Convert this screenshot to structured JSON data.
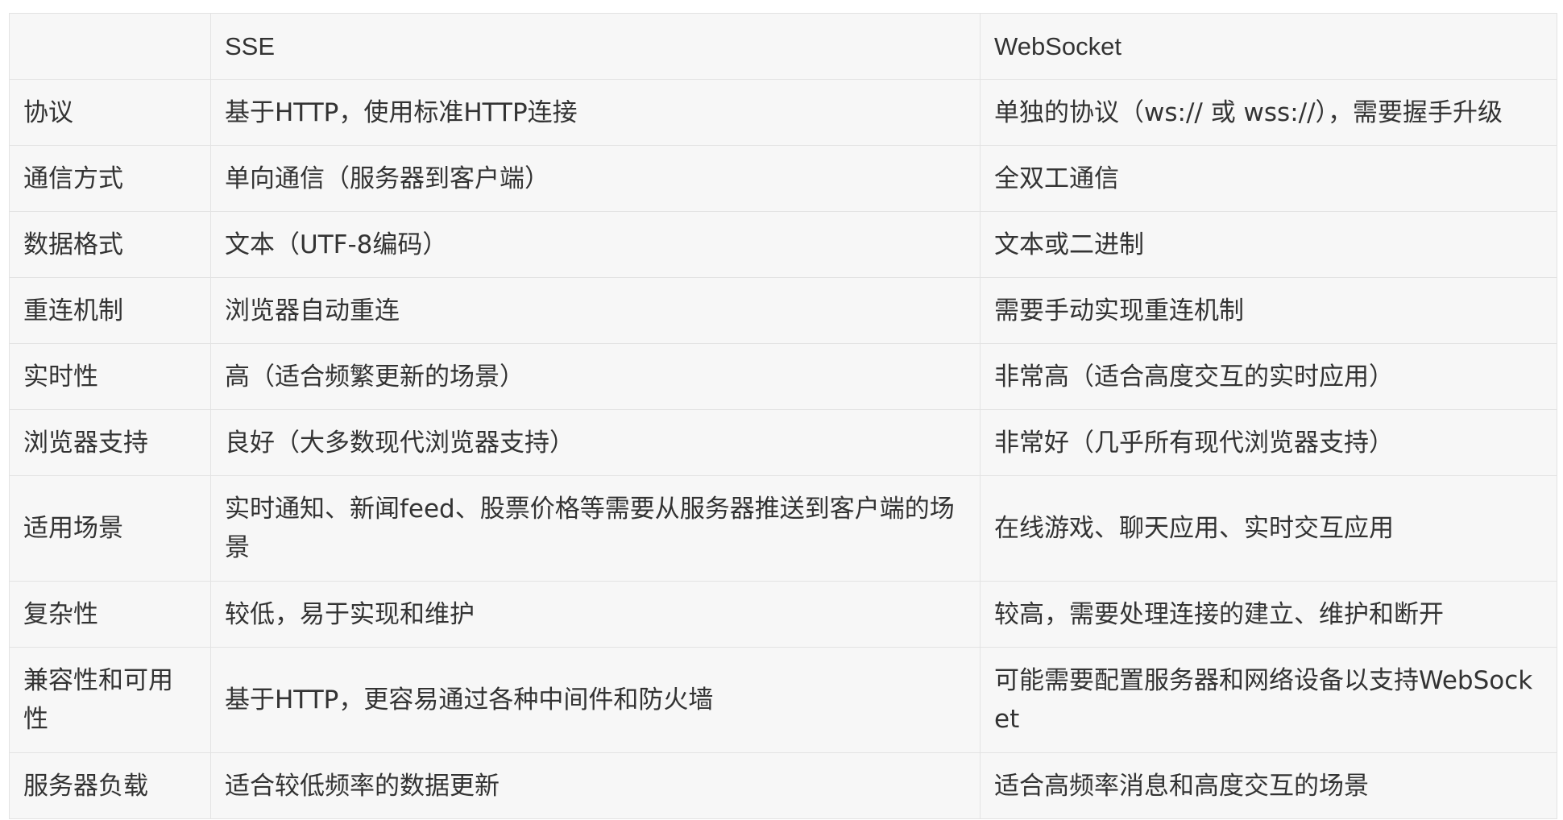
{
  "table": {
    "header": [
      "",
      "SSE",
      "WebSocket"
    ],
    "rows": [
      [
        "协议",
        "基于HTTP，使用标准HTTP连接",
        "单独的协议（ws:// 或 wss://），需要握手升级"
      ],
      [
        "通信方式",
        "单向通信（服务器到客户端）",
        "全双工通信"
      ],
      [
        "数据格式",
        "文本（UTF-8编码）",
        "文本或二进制"
      ],
      [
        "重连机制",
        "浏览器自动重连",
        "需要手动实现重连机制"
      ],
      [
        "实时性",
        "高（适合频繁更新的场景）",
        "非常高（适合高度交互的实时应用）"
      ],
      [
        "浏览器支持",
        "良好（大多数现代浏览器支持）",
        "非常好（几乎所有现代浏览器支持）"
      ],
      [
        "适用场景",
        "实时通知、新闻feed、股票价格等需要从服务器推送到客户端的场景",
        "在线游戏、聊天应用、实时交互应用"
      ],
      [
        "复杂性",
        "较低，易于实现和维护",
        "较高，需要处理连接的建立、维护和断开"
      ],
      [
        "兼容性和可用性",
        "基于HTTP，更容易通过各种中间件和防火墙",
        "可能需要配置服务器和网络设备以支持WebSocket"
      ],
      [
        "服务器负载",
        "适合较低频率的数据更新",
        "适合高频率消息和高度交互的场景"
      ]
    ]
  }
}
